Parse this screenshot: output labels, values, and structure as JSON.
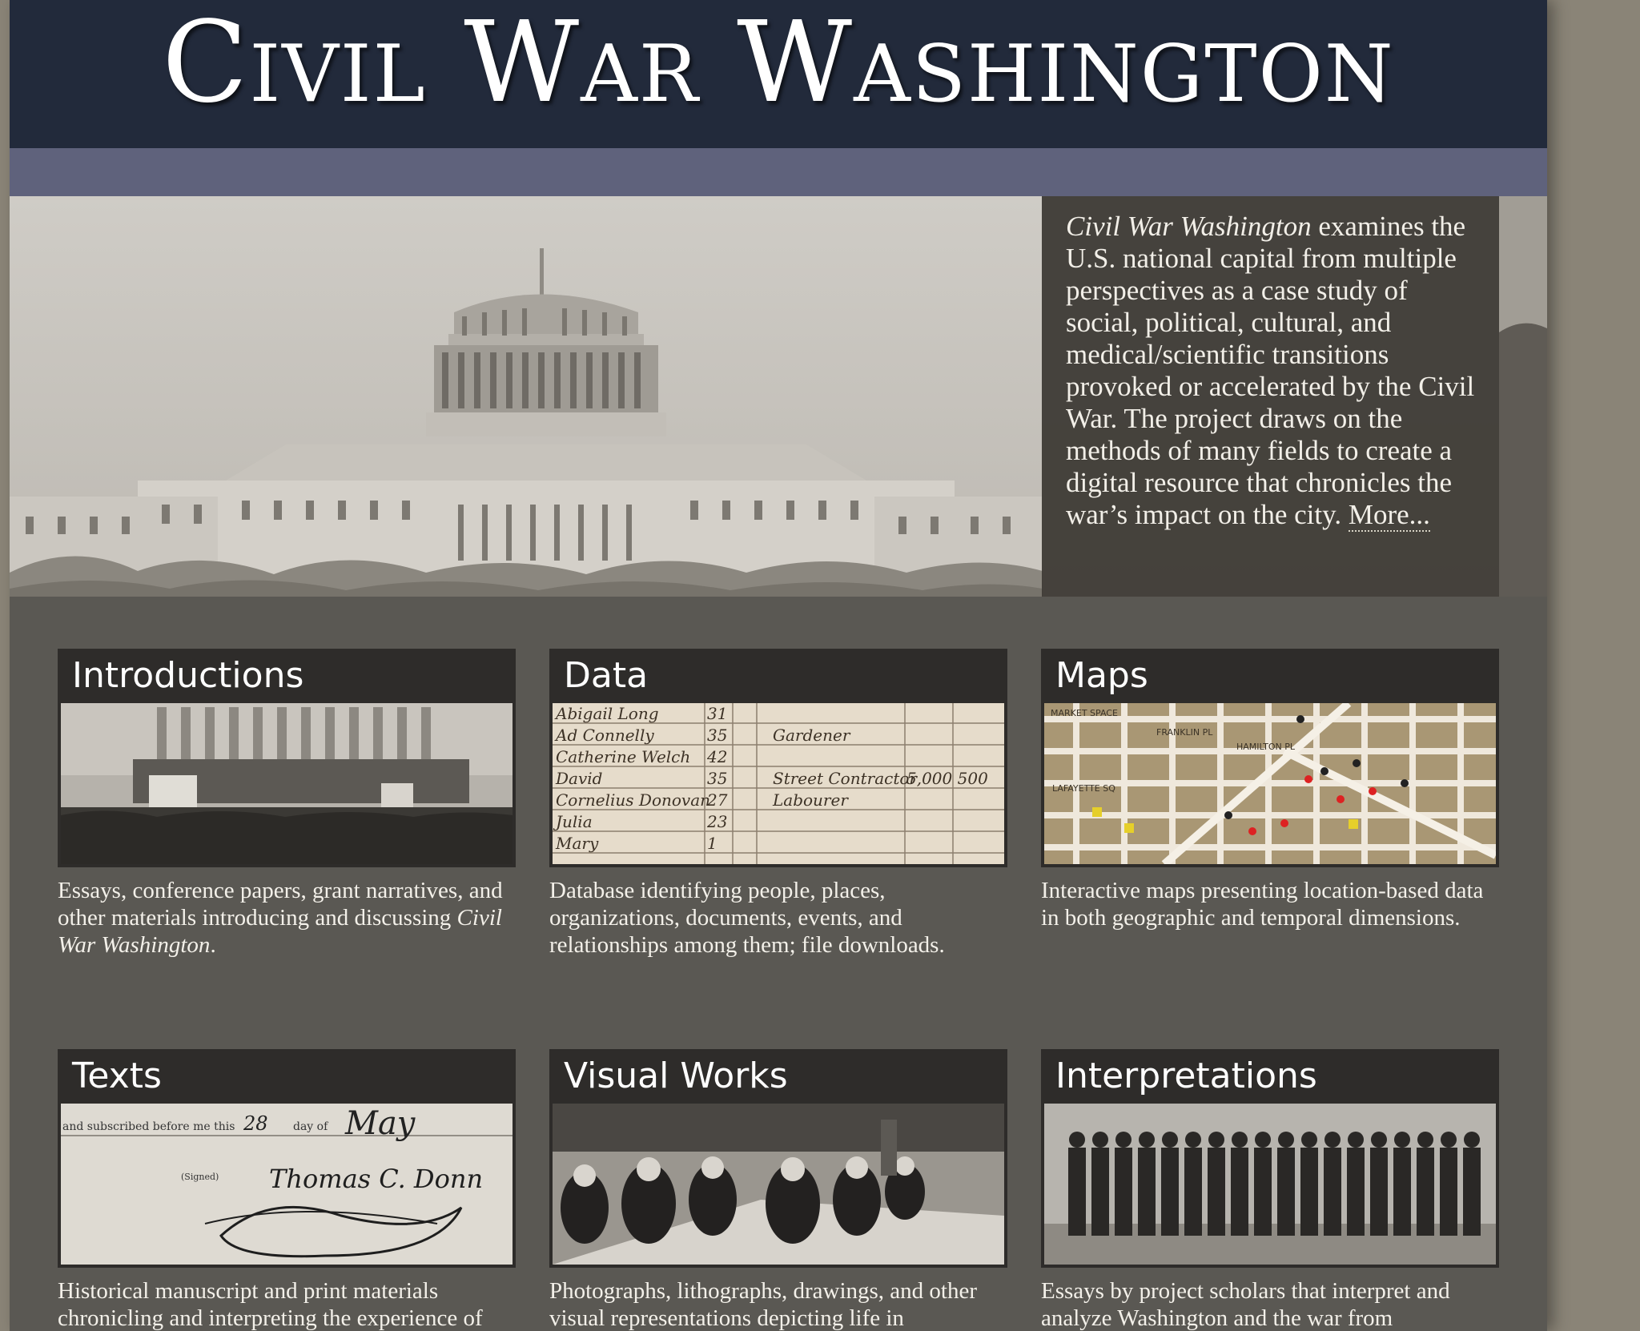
{
  "site": {
    "title": "Civil War Washington"
  },
  "hero": {
    "intro_italic": "Civil War Washington",
    "intro_text": " examines the U.S. national capital from multiple perspectives as a case study of social, political, cultural, and medical/scientific transitions provoked or accelerated by the Civil War. The project draws on the methods of many fields to create a digital resource that chronicles the war’s impact on the city. ",
    "more_link": "More..."
  },
  "sections": {
    "introductions": {
      "title": "Introductions",
      "desc": "Essays, conference papers, grant narratives, and other materials introducing and discussing ",
      "desc_italic": "Civil War Washington",
      "desc_end": "."
    },
    "data": {
      "title": "Data",
      "desc": "Database identifying people, places, organizations, documents, events, and relationships among them; file downloads.",
      "ledger_rows": [
        "Abigail Long",
        "Ad Connelly",
        "Catherine Welch",
        "David",
        "Cornelius Donovan",
        "Julia",
        "Mary"
      ],
      "ledger_ages": [
        "31",
        "35",
        "42",
        "35",
        "27",
        "23",
        "1"
      ],
      "ledger_occupations": [
        "Gardener",
        "Street Contractor",
        "Labourer"
      ],
      "ledger_value": "5,000  500"
    },
    "maps": {
      "title": "Maps",
      "desc": "Interactive maps presenting location-based data in both geographic and temporal dimensions.",
      "map_labels": [
        "MARKET SPACE",
        "FRANKLIN PL",
        "HAMILTON PL",
        "LAFAYETTE SQ"
      ]
    },
    "texts": {
      "title": "Texts",
      "desc": "Historical manuscript and print materials chronicling and interpreting the experience of",
      "doc_line": "and subscribed before me this",
      "doc_day": "28",
      "doc_of": "day of",
      "doc_month": "May",
      "doc_signed": "(Signed)",
      "doc_signature": "Thomas C. Donn"
    },
    "visual_works": {
      "title": "Visual Works",
      "desc": "Photographs, lithographs, drawings, and other visual representations depicting life in"
    },
    "interpretations": {
      "title": "Interpretations",
      "desc": "Essays by project scholars that interpret and analyze Washington and the war from"
    }
  },
  "colors": {
    "header_bg": "#222a3b",
    "nav_bar": "#5f627c",
    "page_bg": "#5a5853",
    "card_header": "#2e2c2a"
  }
}
